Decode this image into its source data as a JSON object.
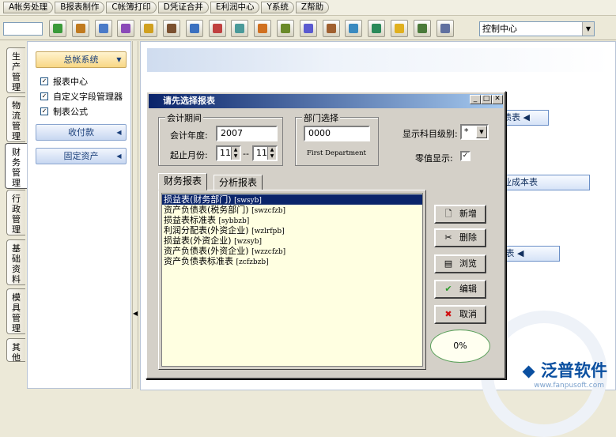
{
  "menu": [
    "A帐务处理",
    "B报表制作",
    "C帐簿打印",
    "D凭证合并",
    "E利润中心",
    "Y系统",
    "Z帮助"
  ],
  "toolbar": {
    "combo_value": "控制中心",
    "icons": [
      "refresh-icon",
      "home-icon",
      "edit-icon",
      "palette-icon",
      "report-icon",
      "book-icon",
      "screen-icon",
      "chart-icon",
      "print-icon",
      "export-icon",
      "tools-icon",
      "calculator-icon",
      "copy-icon",
      "camera-icon",
      "folder-icon",
      "bell-icon",
      "exit-icon",
      "window-icon"
    ]
  },
  "left_tabs": [
    {
      "label": "生产管理"
    },
    {
      "label": "物流管理"
    },
    {
      "label": "财务管理",
      "active": true
    },
    {
      "label": "行政管理"
    },
    {
      "label": "基础资料"
    },
    {
      "label": "模具管理"
    },
    {
      "label": "其他"
    }
  ],
  "nav": {
    "group_main": "总帐系统",
    "links": [
      "报表中心",
      "自定义字段管理器",
      "制表公式"
    ],
    "group_receivable": "收付款",
    "group_assets": "固定资产"
  },
  "main_buttons": {
    "balance_sheet": "负债表",
    "business_cost": "营业成本表",
    "income": "益 表"
  },
  "logo": {
    "brand": "泛普软件",
    "url": "www.fanpusoft.com"
  },
  "dialog": {
    "title": "请先选择报表",
    "period": {
      "legend": "会计期间",
      "year_label": "会计年度:",
      "year": "2007",
      "month_label": "起止月份:",
      "month_from": "11",
      "month_sep": "--",
      "month_to": "11"
    },
    "dept": {
      "legend": "部门选择",
      "code": "0000",
      "name": "First Department"
    },
    "level_label": "显示科目级别:",
    "level_value": "*",
    "zero_label": "零值显示:",
    "zero_checked": true,
    "tabs": [
      "财务报表",
      "分析报表"
    ],
    "reports": [
      {
        "name": "损益表(财务部门)",
        "code": "[swsyb]",
        "selected": true
      },
      {
        "name": "资产负债表(税务部门)",
        "code": "[swzcfzb]"
      },
      {
        "name": "损益表标准表",
        "code": "[sybbzb]"
      },
      {
        "name": "利润分配表(外资企业)",
        "code": "[wzlrfpb]"
      },
      {
        "name": "损益表(外资企业)",
        "code": "[wzsyb]"
      },
      {
        "name": "资产负债表(外资企业)",
        "code": "[wzzcfzb]"
      },
      {
        "name": "资产负债表标准表",
        "code": "[zcfzbzb]"
      }
    ],
    "buttons": {
      "add": "新增",
      "delete": "删除",
      "browse": "浏览",
      "edit": "编辑",
      "cancel": "取消"
    },
    "progress": "0%"
  }
}
